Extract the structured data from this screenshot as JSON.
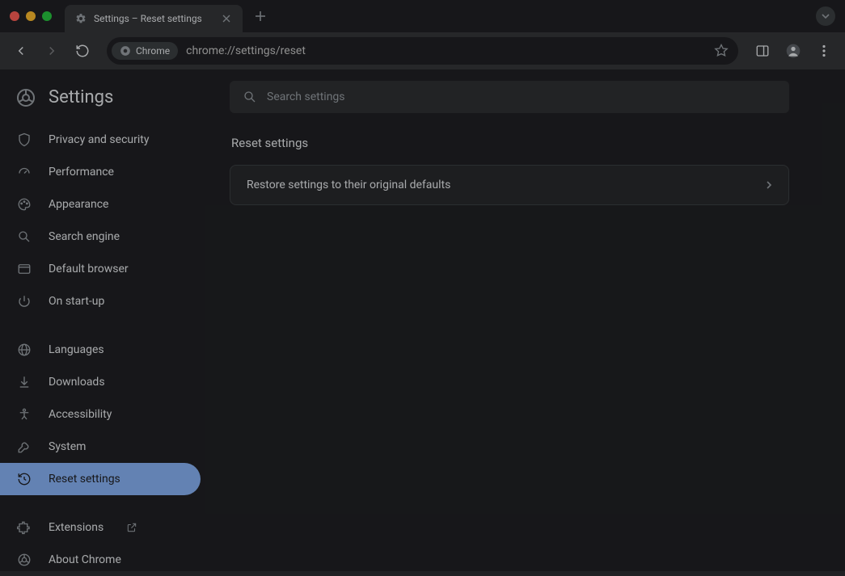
{
  "window": {
    "tab_title": "Settings – Reset settings"
  },
  "toolbar": {
    "site_chip_label": "Chrome",
    "url": "chrome://settings/reset"
  },
  "sidebar": {
    "title": "Settings",
    "items": [
      {
        "label": "Privacy and security",
        "icon": "shield-icon"
      },
      {
        "label": "Performance",
        "icon": "speedometer-icon"
      },
      {
        "label": "Appearance",
        "icon": "palette-icon"
      },
      {
        "label": "Search engine",
        "icon": "search-icon"
      },
      {
        "label": "Default browser",
        "icon": "browser-icon"
      },
      {
        "label": "On start-up",
        "icon": "power-icon"
      }
    ],
    "items2": [
      {
        "label": "Languages",
        "icon": "globe-icon"
      },
      {
        "label": "Downloads",
        "icon": "download-icon"
      },
      {
        "label": "Accessibility",
        "icon": "accessibility-icon"
      },
      {
        "label": "System",
        "icon": "wrench-icon"
      },
      {
        "label": "Reset settings",
        "icon": "history-icon",
        "selected": true
      }
    ],
    "items3": [
      {
        "label": "Extensions",
        "icon": "extension-icon",
        "external": true
      },
      {
        "label": "About Chrome",
        "icon": "chrome-icon"
      }
    ]
  },
  "main": {
    "search_placeholder": "Search settings",
    "section_title": "Reset settings",
    "row_label": "Restore settings to their original defaults"
  }
}
